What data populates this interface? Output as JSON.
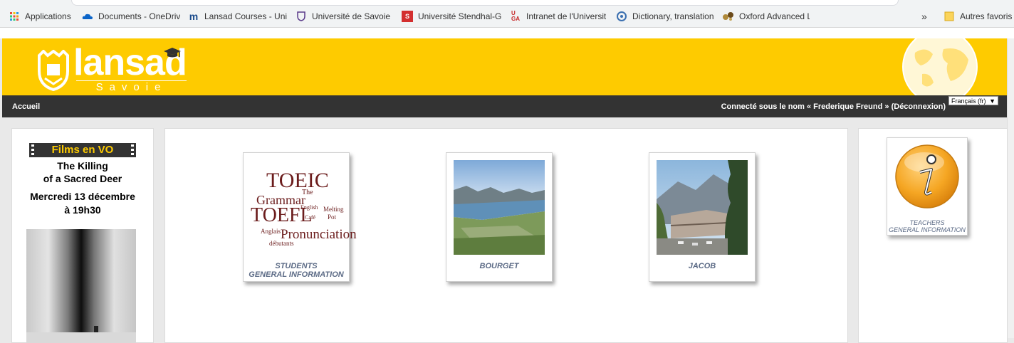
{
  "browser": {
    "bookmarks": [
      {
        "icon": "apps-grid-icon",
        "label": "Applications"
      },
      {
        "icon": "onedrive-cloud-icon",
        "label": "Documents - OneDriv"
      },
      {
        "icon": "moodle-icon",
        "label": "Lansad Courses - Uni"
      },
      {
        "icon": "university-crest-icon",
        "label": "Université de Savoie:"
      },
      {
        "icon": "stendhal-icon",
        "label": "Université Stendhal-G"
      },
      {
        "icon": "uga-icon",
        "label": "Intranet de l'Universit"
      },
      {
        "icon": "wordreference-icon",
        "label": "Dictionary, translation"
      },
      {
        "icon": "oxford-icon",
        "label": "Oxford Advanced Lea"
      },
      {
        "icon": "folder-icon",
        "label": "Autres favoris"
      }
    ],
    "overflow_label": "»"
  },
  "header": {
    "logo_word": "lansad",
    "logo_sub": "Savoie"
  },
  "nav": {
    "home": "Accueil",
    "login_prefix": "Connecté sous le nom « ",
    "user_name": "Frederique Freund",
    "login_mid": " » (",
    "logout": "Déconnexion",
    "login_suffix": ")",
    "language": "Français (fr)"
  },
  "left": {
    "banner": "Films en VO",
    "title_line1": "The Killing",
    "title_line2": "of a Sacred Deer",
    "date_line1": "Mercredi 13 décembre",
    "date_line2": "à 19h30"
  },
  "cards": [
    {
      "cap1": "STUDENTS",
      "cap2": "GENERAL INFORMATION"
    },
    {
      "cap1": "BOURGET"
    },
    {
      "cap1": "JACOB"
    }
  ],
  "wordcloud": [
    "TOEIC",
    "Grammar",
    "The",
    "English",
    "Café",
    "Melting",
    "Pot",
    "TOEFL",
    "Anglais",
    "Pronunciation",
    "débutants"
  ],
  "teachers": {
    "cap1": "TEACHERS",
    "cap2": "GENERAL INFORMATION"
  },
  "colors": {
    "accent": "#fecb00",
    "navbar": "#333333",
    "caption": "#5c6b86"
  }
}
